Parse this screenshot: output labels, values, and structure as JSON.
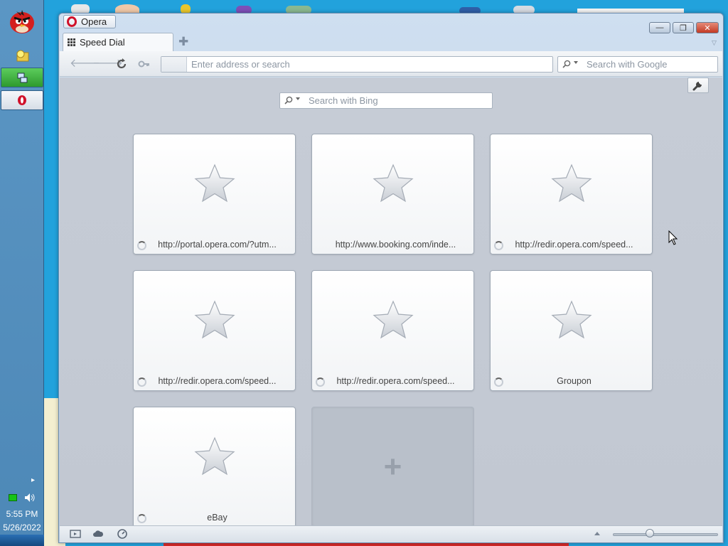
{
  "desktop": {
    "clock_time": "5:55 PM",
    "clock_date": "5/26/2022"
  },
  "window": {
    "app_button_label": "Opera",
    "controls": {
      "minimize": "—",
      "maximize": "❐",
      "close": "✕"
    }
  },
  "tabs": [
    {
      "label": "Speed Dial",
      "active": true
    }
  ],
  "toolbar": {
    "address_placeholder": "Enter address or search",
    "search_placeholder": "Search with Google"
  },
  "speed_dial": {
    "search_placeholder": "Search with Bing",
    "tiles": [
      {
        "label": "http://portal.opera.com/?utm...",
        "loading": true
      },
      {
        "label": "http://www.booking.com/inde...",
        "loading": false
      },
      {
        "label": "http://redir.opera.com/speed...",
        "loading": true
      },
      {
        "label": "http://redir.opera.com/speed...",
        "loading": true
      },
      {
        "label": "http://redir.opera.com/speed...",
        "loading": true
      },
      {
        "label": "Groupon",
        "loading": true
      },
      {
        "label": "eBay",
        "loading": true
      }
    ],
    "add_tile_symbol": "+"
  },
  "statusbar": {
    "zoom_level": 0.35
  },
  "colors": {
    "desktop_blue": "#22a2dc",
    "close_red": "#c33a24",
    "opera_red": "#d0122b"
  }
}
